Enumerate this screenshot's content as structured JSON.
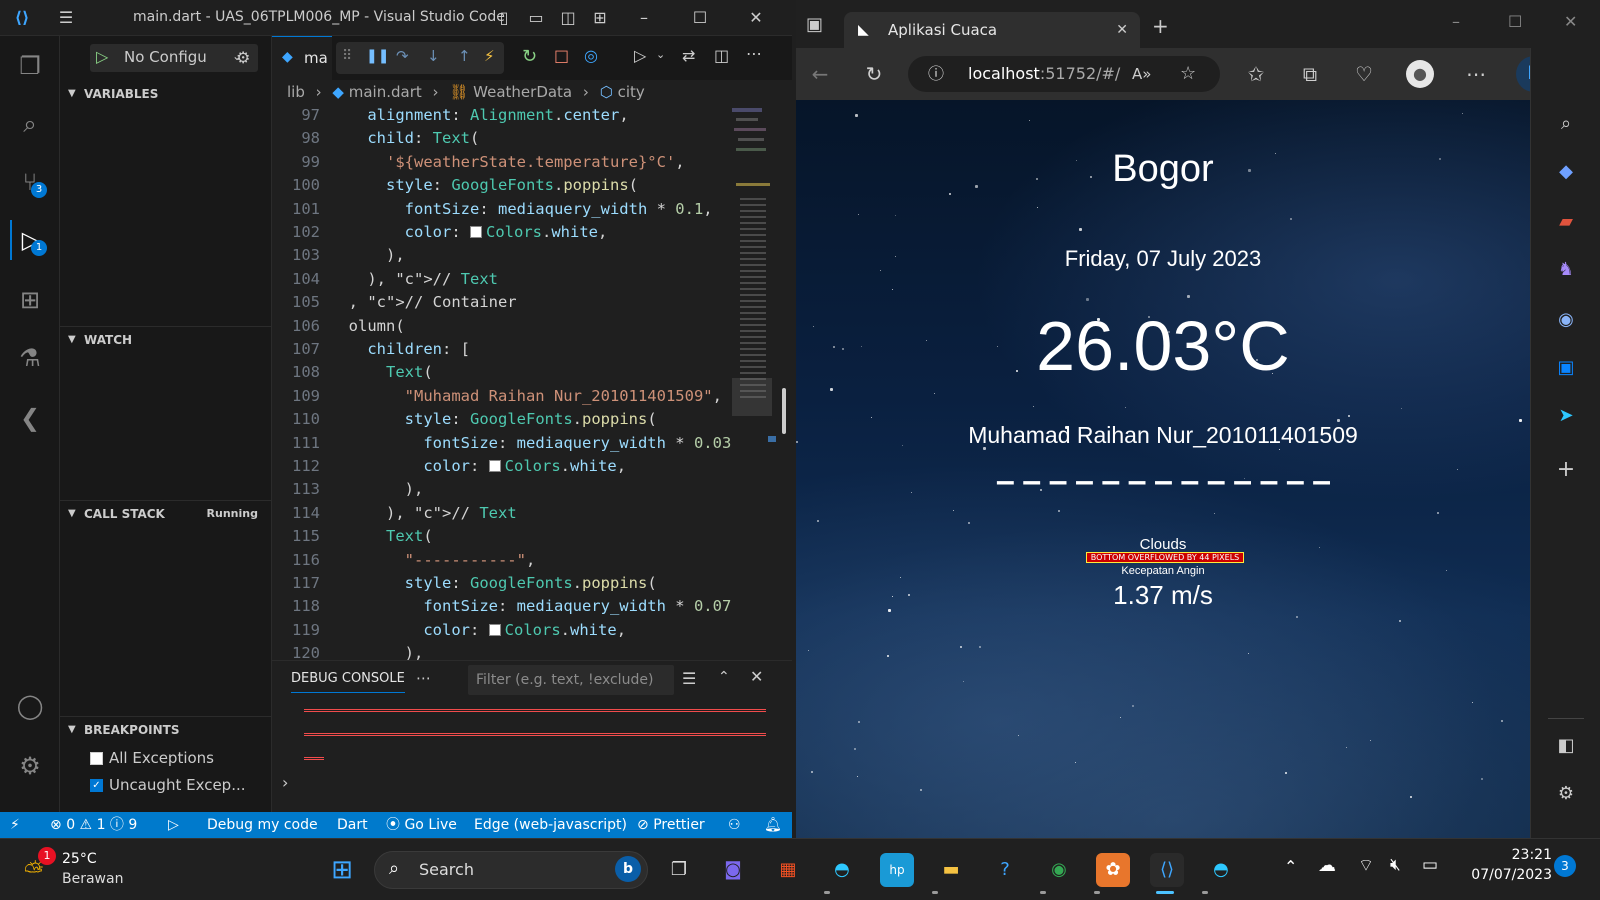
{
  "vscode": {
    "title": "main.dart - UAS_06TPLM006_MP - Visual Studio Code",
    "run_config": "No Configu",
    "tab_label": "ma",
    "sections": {
      "variables": "VARIABLES",
      "watch": "WATCH",
      "call_stack": "CALL STACK",
      "call_stack_status": "Running",
      "breakpoints": "BREAKPOINTS"
    },
    "breakpoints": [
      {
        "label": "All Exceptions",
        "checked": false
      },
      {
        "label": "Uncaught Excep...",
        "checked": true
      }
    ],
    "breadcrumb": [
      "lib",
      "main.dart",
      "WeatherData",
      "city"
    ],
    "code_lines": [
      {
        "n": "97",
        "text": "    alignment: Alignment.center,"
      },
      {
        "n": "98",
        "text": "    child: Text("
      },
      {
        "n": "99",
        "text": "      '${weatherState.temperature}°C',"
      },
      {
        "n": "100",
        "text": "      style: GoogleFonts.poppins("
      },
      {
        "n": "101",
        "text": "        fontSize: mediaquery_width * 0.1,"
      },
      {
        "n": "102",
        "text": "        color: ■Colors.white,"
      },
      {
        "n": "103",
        "text": "      ),"
      },
      {
        "n": "104",
        "text": "    ), // Text"
      },
      {
        "n": "105",
        "text": "  , // Container"
      },
      {
        "n": "106",
        "text": "  olumn("
      },
      {
        "n": "107",
        "text": "    children: ["
      },
      {
        "n": "108",
        "text": "      Text("
      },
      {
        "n": "109",
        "text": "        \"Muhamad Raihan Nur_201011401509\","
      },
      {
        "n": "110",
        "text": "        style: GoogleFonts.poppins("
      },
      {
        "n": "111",
        "text": "          fontSize: mediaquery_width * 0.03"
      },
      {
        "n": "112",
        "text": "          color: ■Colors.white,"
      },
      {
        "n": "113",
        "text": "        ),"
      },
      {
        "n": "114",
        "text": "      ), // Text"
      },
      {
        "n": "115",
        "text": "      Text("
      },
      {
        "n": "116",
        "text": "        \"-----------\","
      },
      {
        "n": "117",
        "text": "        style: GoogleFonts.poppins("
      },
      {
        "n": "118",
        "text": "          fontSize: mediaquery_width * 0.07"
      },
      {
        "n": "119",
        "text": "          color: ■Colors.white,"
      },
      {
        "n": "120",
        "text": "        ),"
      }
    ],
    "panel_tab": "DEBUG CONSOLE",
    "filter_placeholder": "Filter (e.g. text, !exclude)",
    "status": {
      "errors": "0",
      "warnings": "1",
      "info": "9",
      "debug": "Debug my code",
      "language": "Dart",
      "golive": "Go Live",
      "target": "Edge (web-javascript)",
      "prettier": "Prettier"
    }
  },
  "edge": {
    "tab_title": "Aplikasi Cuaca",
    "url_host": "localhost",
    "url_rest": ":51752/#/",
    "weather": {
      "city": "Bogor",
      "date": "Friday, 07 July 2023",
      "temperature": "26.03°C",
      "name": "Muhamad Raihan Nur_201011401509",
      "dashes": "– – – – – – – – – – – – –",
      "condition": "Clouds",
      "overflow_warning": "BOTTOM OVERFLOWED BY 44 PIXELS",
      "wind_label": "Kecepatan Angin",
      "wind_value": "1.37 m/s"
    }
  },
  "taskbar": {
    "weather_temp": "25°C",
    "weather_desc": "Berawan",
    "weather_badge": "1",
    "search_label": "Search",
    "time": "23:21",
    "date": "07/07/2023",
    "notif_count": "3"
  }
}
